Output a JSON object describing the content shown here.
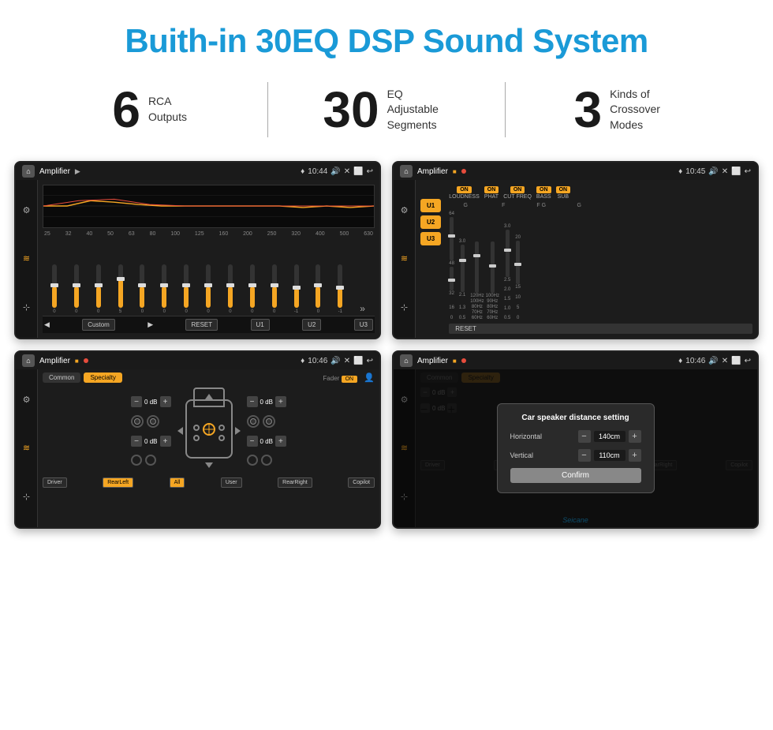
{
  "header": {
    "title": "Buith-in 30EQ DSP Sound System"
  },
  "stats": [
    {
      "number": "6",
      "label": "RCA\nOutputs"
    },
    {
      "number": "30",
      "label": "EQ Adjustable\nSegments"
    },
    {
      "number": "3",
      "label": "Kinds of\nCrossover Modes"
    }
  ],
  "screens": {
    "eq": {
      "title": "Amplifier",
      "time": "10:44",
      "freqs": [
        "25",
        "32",
        "40",
        "50",
        "63",
        "80",
        "100",
        "125",
        "160",
        "200",
        "250",
        "320",
        "400",
        "500",
        "630"
      ],
      "values": [
        0,
        0,
        0,
        5,
        0,
        0,
        0,
        0,
        0,
        0,
        0,
        -1,
        0,
        -1
      ],
      "preset": "Custom",
      "buttons": [
        "RESET",
        "U1",
        "U2",
        "U3"
      ]
    },
    "amplifier": {
      "title": "Amplifier",
      "time": "10:45",
      "presets": [
        "U1",
        "U2",
        "U3"
      ],
      "channels": [
        "LOUDNESS",
        "PHAT",
        "CUT FREQ",
        "BASS",
        "SUB"
      ],
      "reset": "RESET"
    },
    "fader": {
      "title": "Amplifier",
      "time": "10:46",
      "tabs": [
        "Common",
        "Specialty"
      ],
      "faderLabel": "Fader",
      "onBadge": "ON",
      "positions": {
        "fl": "0 dB",
        "fr": "0 dB",
        "rl": "0 dB",
        "rr": "0 dB"
      },
      "buttons": [
        "Driver",
        "RearLeft",
        "All",
        "User",
        "RearRight",
        "Copilot"
      ]
    },
    "dialog": {
      "title": "Amplifier",
      "time": "10:46",
      "dialogTitle": "Car speaker distance setting",
      "horizontal": {
        "label": "Horizontal",
        "value": "140cm"
      },
      "vertical": {
        "label": "Vertical",
        "value": "110cm"
      },
      "confirmBtn": "Confirm",
      "watermark": "Seicane"
    }
  },
  "icons": {
    "home": "⌂",
    "location": "♦",
    "speaker": "🔊",
    "close": "✕",
    "back": "↩",
    "dots": "••",
    "equalizer": "≡",
    "waveform": "∿",
    "arrows": "⊹"
  }
}
